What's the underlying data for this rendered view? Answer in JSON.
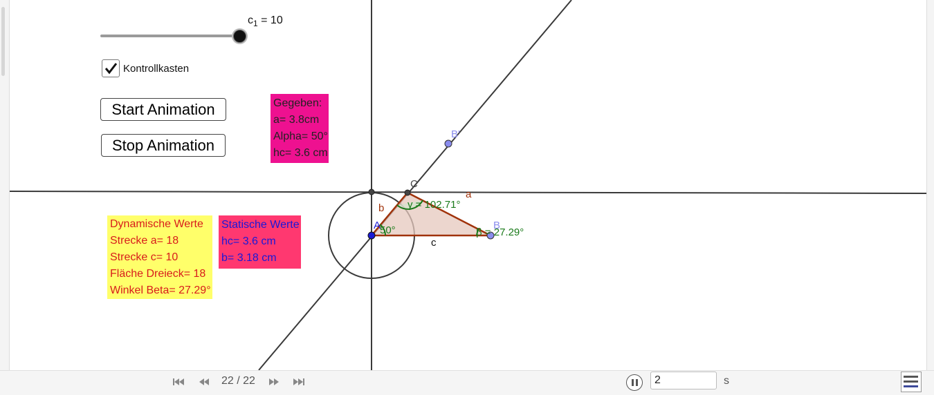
{
  "slider": {
    "label_base": "c",
    "label_sub": "1",
    "label_value": " = 10",
    "value": 10,
    "fill_fraction": 1.0
  },
  "checkbox": {
    "label": "Kontrollkasten",
    "checked": true
  },
  "buttons": {
    "start": "Start Animation",
    "stop": "Stop Animation"
  },
  "given_box": {
    "lines": [
      "Gegeben:",
      "a= 3.8cm",
      "Alpha= 50°",
      "hc= 3.6 cm"
    ],
    "color": "#ee1190"
  },
  "dynamic_box": {
    "lines": [
      "Dynamische Werte",
      "Strecke a= 18",
      "Strecke c= 10",
      "Fläche Dreieck= 18",
      "Winkel Beta= 27.29°"
    ],
    "color": "#ffff6a",
    "text_color": "#d81b1b"
  },
  "static_box": {
    "lines": [
      "Statische Werte",
      "hc= 3.6 cm",
      "b= 3.18 cm"
    ],
    "color": "#ff3870",
    "text_color": "#1818d8"
  },
  "geometry": {
    "points": {
      "A": "A",
      "B": "B",
      "C": "C",
      "B_prime": "B'"
    },
    "sides": {
      "a": "a",
      "b": "b",
      "c": "c"
    },
    "angles": {
      "alpha": "50°",
      "beta": "β = 27.29°",
      "gamma": "γ = 102.71°"
    }
  },
  "bottom_bar": {
    "step": "22 / 22",
    "speed_value": "2",
    "speed_unit": "s",
    "icons": [
      "skip-back-icon",
      "step-back-icon",
      "step-forward-icon",
      "skip-forward-icon",
      "pause-icon",
      "algebra-view-icon"
    ]
  }
}
